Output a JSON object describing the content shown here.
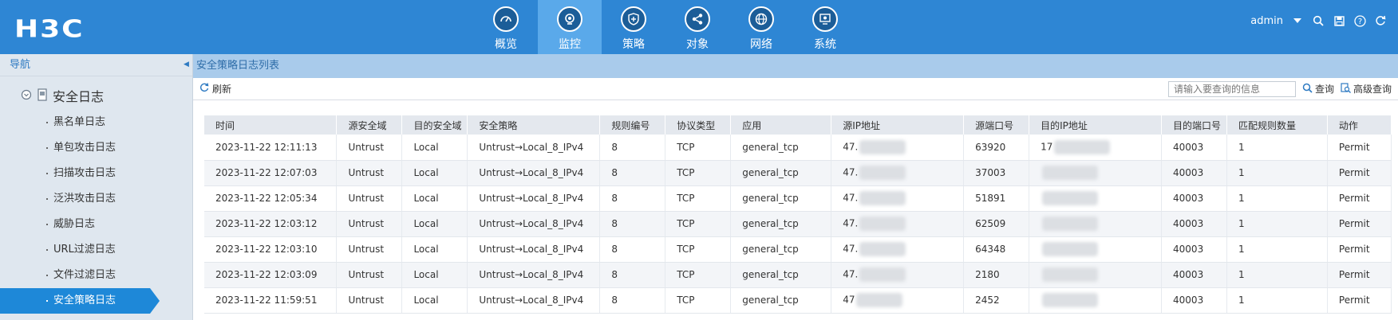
{
  "brand": {
    "logo_text": "H3C"
  },
  "nav": {
    "items": [
      {
        "label": "概览",
        "icon": "gauge-icon",
        "active": false
      },
      {
        "label": "监控",
        "icon": "monitor-eye-icon",
        "active": true
      },
      {
        "label": "策略",
        "icon": "shield-plus-icon",
        "active": false
      },
      {
        "label": "对象",
        "icon": "share-nodes-icon",
        "active": false
      },
      {
        "label": "网络",
        "icon": "globe-icon",
        "active": false
      },
      {
        "label": "系统",
        "icon": "system-settings-icon",
        "active": false
      }
    ]
  },
  "user": {
    "name": "admin"
  },
  "sidebar": {
    "header": "导航",
    "group_label": "安全日志",
    "items": [
      {
        "label": "黑名单日志"
      },
      {
        "label": "单包攻击日志"
      },
      {
        "label": "扫描攻击日志"
      },
      {
        "label": "泛洪攻击日志"
      },
      {
        "label": "威胁日志"
      },
      {
        "label": "URL过滤日志"
      },
      {
        "label": "文件过滤日志"
      },
      {
        "label": "安全策略日志"
      }
    ],
    "active_index": 7
  },
  "main": {
    "breadcrumb": "安全策略日志列表",
    "toolbar": {
      "refresh_label": "刷新",
      "search_placeholder": "请输入要查询的信息",
      "query_label": "查询",
      "advanced_label": "高级查询"
    },
    "table": {
      "columns": [
        "时间",
        "源安全域",
        "目的安全域",
        "安全策略",
        "规则编号",
        "协议类型",
        "应用",
        "源IP地址",
        "源端口号",
        "目的IP地址",
        "目的端口号",
        "匹配规则数量",
        "动作"
      ],
      "rows": [
        [
          "2023-11-22 12:11:13",
          "Untrust",
          "Local",
          "Untrust→Local_8_IPv4",
          "8",
          "TCP",
          "general_tcp",
          "47.",
          "63920",
          "17",
          "40003",
          "1",
          "Permit"
        ],
        [
          "2023-11-22 12:07:03",
          "Untrust",
          "Local",
          "Untrust→Local_8_IPv4",
          "8",
          "TCP",
          "general_tcp",
          "47.",
          "37003",
          "",
          "40003",
          "1",
          "Permit"
        ],
        [
          "2023-11-22 12:05:34",
          "Untrust",
          "Local",
          "Untrust→Local_8_IPv4",
          "8",
          "TCP",
          "general_tcp",
          "47.",
          "51891",
          "",
          "40003",
          "1",
          "Permit"
        ],
        [
          "2023-11-22 12:03:12",
          "Untrust",
          "Local",
          "Untrust→Local_8_IPv4",
          "8",
          "TCP",
          "general_tcp",
          "47.",
          "62509",
          "",
          "40003",
          "1",
          "Permit"
        ],
        [
          "2023-11-22 12:03:10",
          "Untrust",
          "Local",
          "Untrust→Local_8_IPv4",
          "8",
          "TCP",
          "general_tcp",
          "47.",
          "64348",
          "",
          "40003",
          "1",
          "Permit"
        ],
        [
          "2023-11-22 12:03:09",
          "Untrust",
          "Local",
          "Untrust→Local_8_IPv4",
          "8",
          "TCP",
          "general_tcp",
          "47.",
          "2180",
          "",
          "40003",
          "1",
          "Permit"
        ],
        [
          "2023-11-22 11:59:51",
          "Untrust",
          "Local",
          "Untrust→Local_8_IPv4",
          "8",
          "TCP",
          "general_tcp",
          "47",
          "2452",
          "",
          "40003",
          "1",
          "Permit"
        ]
      ]
    }
  },
  "colors": {
    "topbar": "#2e86d4",
    "nav_active": "#5aa9ea",
    "sidebar_active": "#1e88d8",
    "breadcrumb_bg": "#a9cbeb"
  }
}
